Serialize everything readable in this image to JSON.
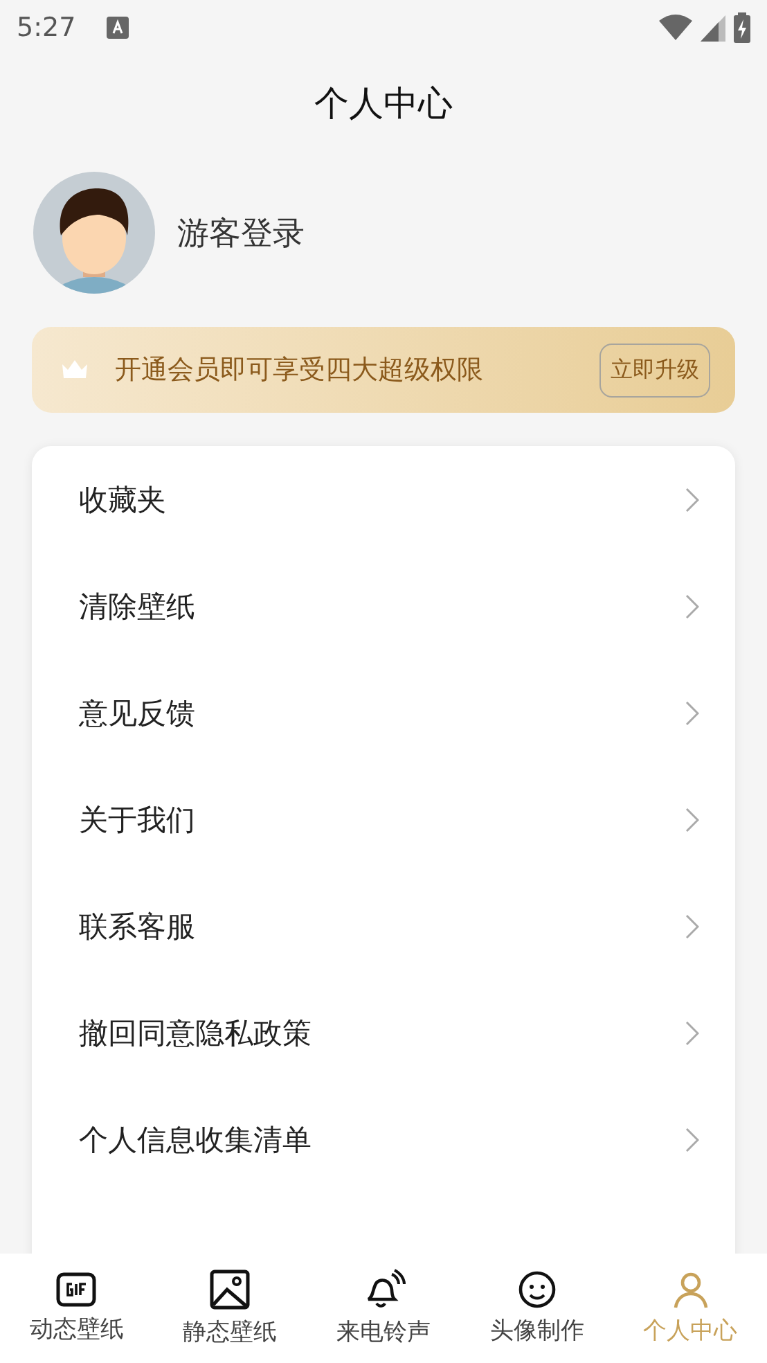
{
  "status_bar": {
    "time": "5:27"
  },
  "header": {
    "title": "个人中心"
  },
  "profile": {
    "name": "游客登录"
  },
  "vip_banner": {
    "text": "开通会员即可享受四大超级权限",
    "button": "立即升级"
  },
  "menu": [
    {
      "label": "收藏夹"
    },
    {
      "label": "清除壁纸"
    },
    {
      "label": "意见反馈"
    },
    {
      "label": "关于我们"
    },
    {
      "label": "联系客服"
    },
    {
      "label": "撤回同意隐私政策"
    },
    {
      "label": "个人信息收集清单"
    }
  ],
  "bottom_nav": [
    {
      "kind": "gif",
      "label": "动态壁纸",
      "selected": false
    },
    {
      "kind": "image",
      "label": "静态壁纸",
      "selected": false
    },
    {
      "kind": "bell",
      "label": "来电铃声",
      "selected": false
    },
    {
      "kind": "avatar",
      "label": "头像制作",
      "selected": false
    },
    {
      "kind": "person",
      "label": "个人中心",
      "selected": true
    }
  ]
}
